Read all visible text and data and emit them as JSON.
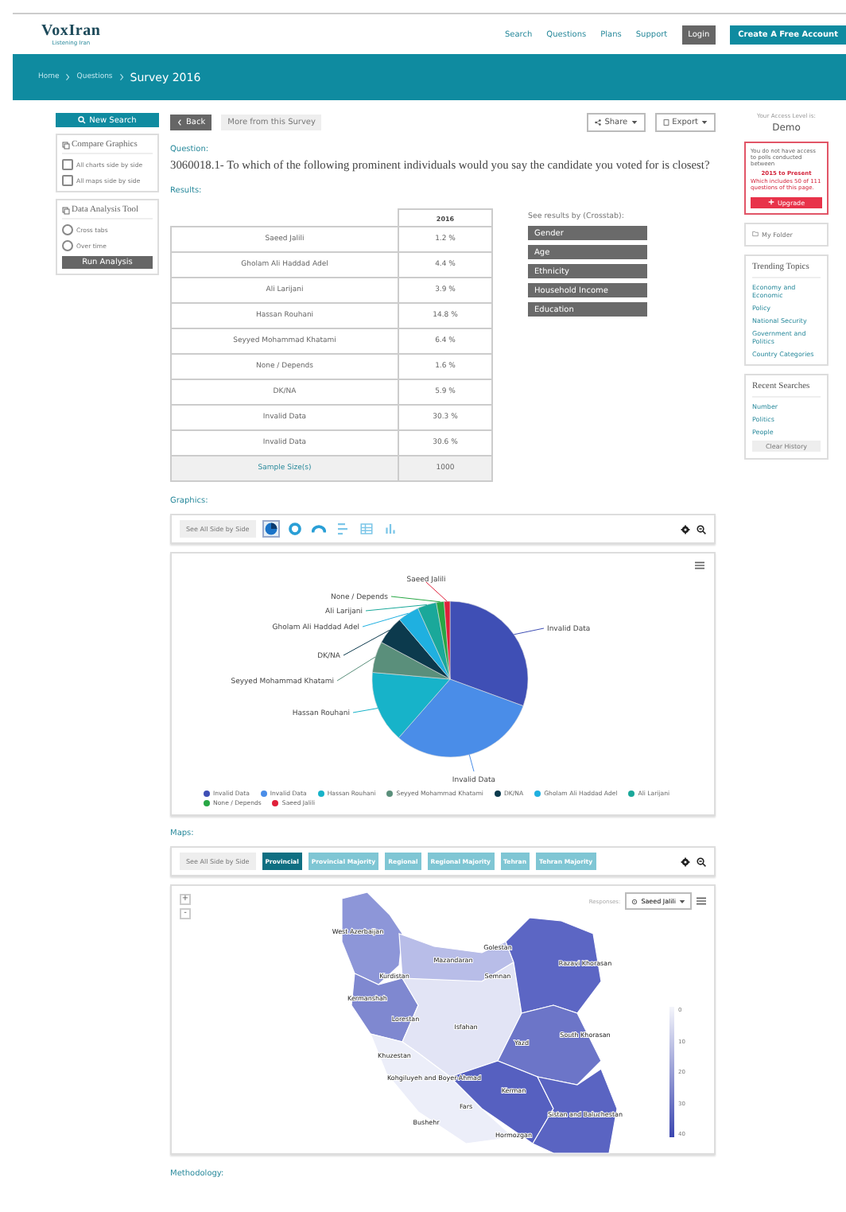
{
  "header": {
    "logo": "VoxIran",
    "tagline": "Listening Iran",
    "nav": [
      "Search",
      "Questions",
      "Plans",
      "Support"
    ],
    "login": "Login",
    "signup": "Create A Free Account"
  },
  "breadcrumb": [
    "Home",
    "Questions",
    "Survey 2016"
  ],
  "sidebar": {
    "new_search": "New Search",
    "compare": {
      "title": "Compare Graphics",
      "options": [
        {
          "label": "All charts side by side",
          "checked": false
        },
        {
          "label": "All maps side by side",
          "checked": false
        }
      ]
    },
    "analysis": {
      "title": "Data Analysis Tool",
      "options": [
        {
          "label": "Cross tabs",
          "selected": false
        },
        {
          "label": "Over time",
          "selected": false
        }
      ],
      "button": "Run Analysis"
    }
  },
  "toolbar": {
    "back": "Back",
    "more": "More from this Survey",
    "share": "Share",
    "export": "Export"
  },
  "question": {
    "label": "Question:",
    "text": "3060018.1- To which of the following prominent individuals would you say the candidate you voted for is closest?"
  },
  "results": {
    "label": "Results:",
    "column": "2016",
    "rows": [
      {
        "name": "Saeed Jalili",
        "value": "1.2 %"
      },
      {
        "name": "Gholam Ali Haddad Adel",
        "value": "4.4 %"
      },
      {
        "name": "Ali Larijani",
        "value": "3.9 %"
      },
      {
        "name": "Hassan Rouhani",
        "value": "14.8 %"
      },
      {
        "name": "Seyyed Mohammad Khatami",
        "value": "6.4 %"
      },
      {
        "name": "None / Depends",
        "value": "1.6 %"
      },
      {
        "name": "DK/NA",
        "value": "5.9 %"
      },
      {
        "name": "Invalid Data",
        "value": "30.3 %"
      },
      {
        "name": "Invalid Data",
        "value": "30.6 %"
      }
    ],
    "total": {
      "name": "Sample Size(s)",
      "value": "1000"
    }
  },
  "crosstab": {
    "label": "See results by (Crosstab):",
    "items": [
      "Gender",
      "Age",
      "Ethnicity",
      "Household Income",
      "Education"
    ]
  },
  "graphics": {
    "label": "Graphics:",
    "side_by_side": "See All Side by Side",
    "chart_types": [
      {
        "kind": "pie",
        "selected": true
      },
      {
        "kind": "donut",
        "selected": false
      },
      {
        "kind": "semi",
        "selected": false
      },
      {
        "kind": "bar",
        "selected": false
      },
      {
        "kind": "table",
        "selected": false
      },
      {
        "kind": "column",
        "selected": false
      }
    ],
    "slice_labels": [
      "Saeed Jalili",
      "None / Depends",
      "Ali Larijani",
      "Gholam Ali Haddad Adel",
      "Invalid Data",
      "DK/NA",
      "Seyyed Mohammad Khatami",
      "Hassan Rouhani",
      "Invalid Data"
    ],
    "legend": [
      {
        "label": "Invalid Data",
        "color": "#3f4fb5"
      },
      {
        "label": "Invalid Data",
        "color": "#4a8de8"
      },
      {
        "label": "Hassan Rouhani",
        "color": "#17b3c9"
      },
      {
        "label": "Seyyed Mohammad Khatami",
        "color": "#5a8f7b"
      },
      {
        "label": "DK/NA",
        "color": "#0c3a4d"
      },
      {
        "label": "Gholam Ali Haddad Adel",
        "color": "#1fb0e0"
      },
      {
        "label": "Ali Larijani",
        "color": "#1aa89a"
      },
      {
        "label": "None / Depends",
        "color": "#28a745"
      },
      {
        "label": "Saeed Jalili",
        "color": "#e0203a"
      }
    ]
  },
  "maps": {
    "label": "Maps:",
    "side_by_side": "See All Side by Side",
    "modes": [
      {
        "label": "Provincial",
        "selected": true
      },
      {
        "label": "Provincial Majority",
        "selected": false
      },
      {
        "label": "Regional",
        "selected": false
      },
      {
        "label": "Regional Majority",
        "selected": false
      },
      {
        "label": "Tehran",
        "selected": false
      },
      {
        "label": "Tehran Majority",
        "selected": false
      }
    ],
    "responses_label": "Responses:",
    "response": "Saeed Jalili",
    "zoom_in": "+",
    "zoom_out": "-",
    "provinces": [
      "West Azerbaijan",
      "Golestan",
      "Razavi Khorasan",
      "Mazandaran",
      "Semnan",
      "Kermanshah",
      "Kurdistan",
      "Lorestan",
      "Isfahan",
      "Yazd",
      "South Khorasan",
      "Khuzestan",
      "Kohgiluyeh and Boyer-Ahmad",
      "Fars",
      "Kerman",
      "Bushehr",
      "Hormozgan",
      "Sistan and Baluchestan"
    ],
    "scale": [
      "0",
      "10",
      "20",
      "30",
      "40"
    ]
  },
  "methodology": "Methodology:",
  "access": {
    "label": "Your Access Level is:",
    "level": "Demo",
    "notice": "You do not have access to polls conducted between",
    "range": "2015 to Present",
    "detail": "Which includes 50 of 111 questions of this page.",
    "upgrade": "Upgrade"
  },
  "folder": "My Folder",
  "trending": {
    "title": "Trending Topics",
    "items": [
      "Economy and Economic",
      "Policy",
      "National Security",
      "Government and Politics",
      "Country Categories"
    ]
  },
  "recent": {
    "title": "Recent Searches",
    "items": [
      "Number",
      "Politics",
      "People"
    ],
    "clear": "Clear History"
  }
}
